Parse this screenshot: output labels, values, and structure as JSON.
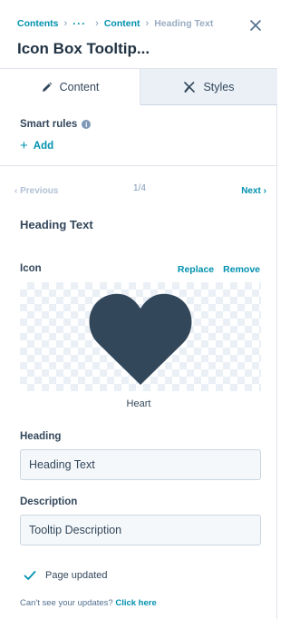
{
  "header": {
    "breadcrumb": {
      "root": "Contents",
      "more": "···",
      "parent": "Content",
      "current": "Heading Text"
    },
    "title": "Icon Box Tooltip...",
    "close_icon": "close-icon"
  },
  "tabs": [
    {
      "label": "Content",
      "icon": "pencil-icon",
      "active": true
    },
    {
      "label": "Styles",
      "icon": "brush-icon",
      "active": false
    }
  ],
  "smart_rules": {
    "label": "Smart rules",
    "add_label": "Add"
  },
  "pager": {
    "prev_label": "Previous",
    "count": "1/4",
    "next_label": "Next"
  },
  "section": {
    "title": "Heading Text"
  },
  "icon_field": {
    "label": "Icon",
    "replace_label": "Replace",
    "remove_label": "Remove",
    "icon_name": "Heart",
    "icon_color": "#33475b"
  },
  "heading_field": {
    "label": "Heading",
    "value": "Heading Text"
  },
  "description_field": {
    "label": "Description",
    "value": "Tooltip Description"
  },
  "status": {
    "text": "Page updated",
    "icon": "check-icon"
  },
  "footnote": {
    "text": "Can't see your updates?",
    "link": "Click here"
  },
  "colors": {
    "accent": "#0091ae",
    "text": "#33475b",
    "border": "#dfe3eb"
  }
}
